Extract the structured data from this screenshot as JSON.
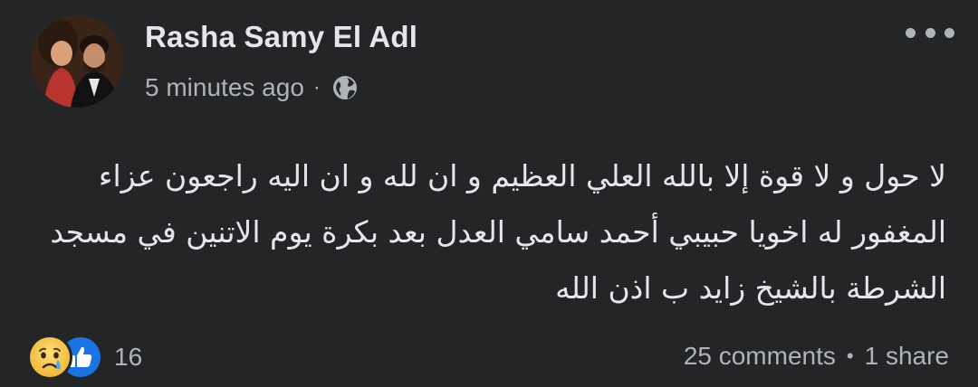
{
  "post": {
    "author": "Rasha Samy El Adl",
    "timestamp": "5 minutes ago",
    "meta_separator": "·",
    "privacy_icon": "globe-icon",
    "text": "لا حول و لا قوة إلا بالله العلي العظيم و ان لله و ان اليه راجعون عزاء المغفور له اخويا حبيبي أحمد سامي العدل بعد بكرة يوم الاتنين في مسجد الشرطة بالشيخ زايد ب اذن الله",
    "reactions": {
      "icons": [
        "sad-icon",
        "like-icon"
      ],
      "count": "16"
    },
    "comments": "25 comments",
    "footer_separator": "•",
    "shares": "1 share"
  },
  "colors": {
    "background": "#242526",
    "primary_text": "#e4e6eb",
    "secondary_text": "#b0b3b8",
    "like_blue": "#1b74e4",
    "sad_yellow": "#f7c53c"
  }
}
